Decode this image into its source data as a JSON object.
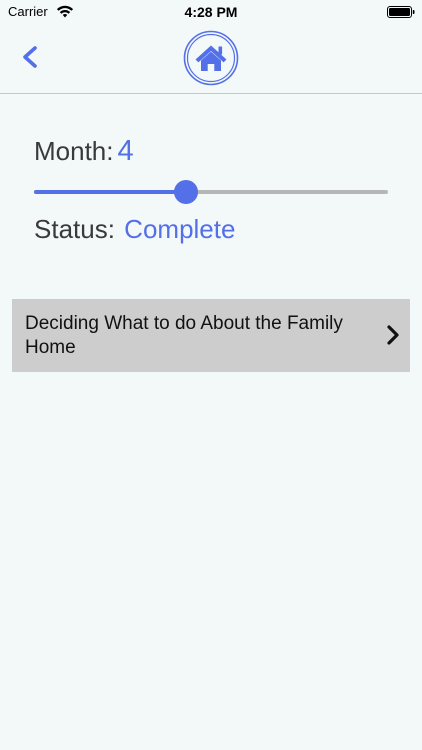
{
  "status_bar": {
    "carrier": "Carrier",
    "time": "4:28 PM"
  },
  "nav": {
    "back_icon": "chevron-left-icon",
    "home_icon": "house-icon"
  },
  "progress": {
    "month_label": "Month:",
    "month_value": "4",
    "slider_fraction": 0.43,
    "status_label": "Status:",
    "status_value": "Complete"
  },
  "list": {
    "items": [
      {
        "title": "Deciding What to do About the Family Home",
        "icon": "chevron-right-icon"
      }
    ]
  },
  "colors": {
    "accent": "#5470e8",
    "background": "#f3f8f8",
    "list_item_bg": "#cdcdcd",
    "track": "#b6b6b6"
  }
}
